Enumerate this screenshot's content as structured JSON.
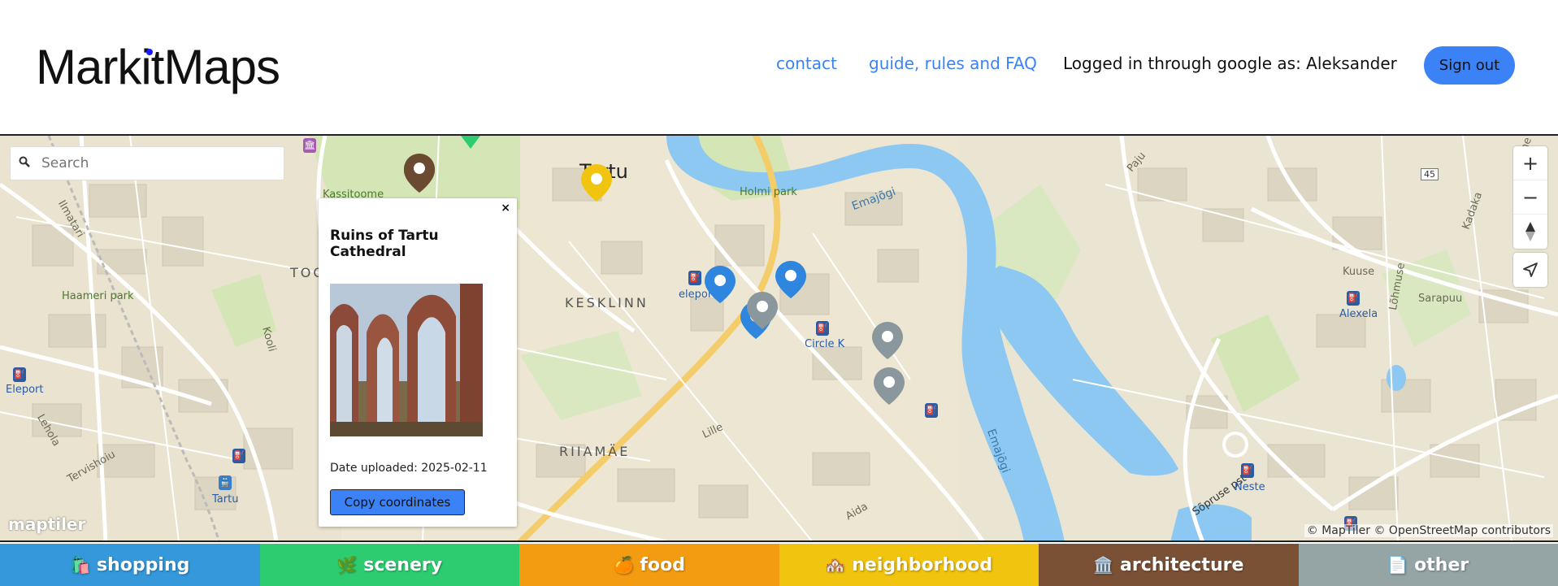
{
  "header": {
    "logo": "MarkitMaps",
    "nav": [
      {
        "label": "contact"
      },
      {
        "label": "guide, rules and FAQ"
      }
    ],
    "login_text": "Logged in through google as: Aleksander",
    "signout_label": "Sign out"
  },
  "search": {
    "placeholder": "Search"
  },
  "map": {
    "labels": {
      "tartu": "Tartu",
      "kesklinn": "KESKLINN",
      "riiamae": "RIIAMÄE",
      "toome": "TOO",
      "emajogi1": "Emajõgi",
      "emajogi2": "Emajõgi",
      "holmi": "Holmi park",
      "kassitoome": "Kassitoome",
      "hameri": "Haameri park",
      "ilmatari": "Ilmatari",
      "kooli": "Kooli",
      "lehola": "Lehola",
      "tervishoiu": "Tervishoiu",
      "lille": "Lille",
      "aida": "Aida",
      "paju": "Paju",
      "kuuse": "Kuuse",
      "sarapuu": "Sarapuu",
      "lohmuse": "Lõhmuse",
      "kadaka": "Kadaka",
      "lehe": "Lehe",
      "soprus": "Sõpruse pst",
      "route": "45",
      "eleport_left": "Eleport",
      "eleport_mid": "eleport",
      "circle_k": "Circle K",
      "alexela": "Alexela",
      "neste": "Neste",
      "tartu_station": "Tartu"
    },
    "attribution": "© MapTiler © OpenStreetMap contributors",
    "maptiler": "maptiler",
    "controls": {
      "zoom_in": "+",
      "zoom_out": "−"
    }
  },
  "popup": {
    "close": "×",
    "title": "Ruins of Tartu Cathedral",
    "date": "Date uploaded: 2025-02-11",
    "copy_label": "Copy coordinates"
  },
  "categories": [
    {
      "label": "shopping",
      "icon": "🛍️",
      "color": "#3498db"
    },
    {
      "label": "scenery",
      "icon": "🌿",
      "color": "#2ecc71"
    },
    {
      "label": "food",
      "icon": "🍊",
      "color": "#f39c12"
    },
    {
      "label": "neighborhood",
      "icon": "🏘️",
      "color": "#f1c40f"
    },
    {
      "label": "architecture",
      "icon": "🏛️",
      "color": "#7b5136"
    },
    {
      "label": "other",
      "icon": "📄",
      "color": "#95a5a6"
    }
  ],
  "colors": {
    "accent": "#3b82f6",
    "pin_blue": "#2e86de",
    "pin_gray": "#8a979c",
    "pin_brown": "#6b4a32",
    "pin_yellow": "#f1c40f",
    "water": "#8cc8f2"
  }
}
